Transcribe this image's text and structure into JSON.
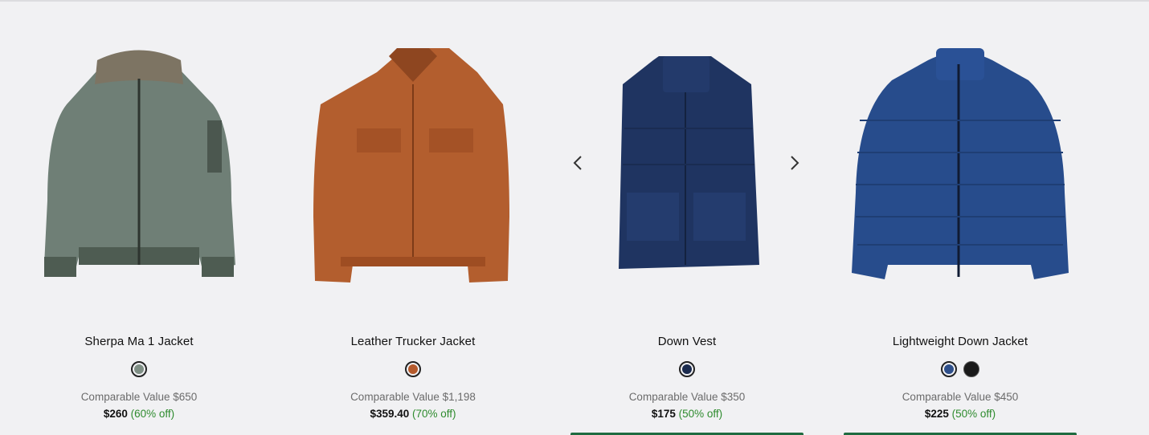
{
  "carousel": {
    "prev_label": "previous",
    "next_label": "next"
  },
  "products": [
    {
      "name": "Sherpa Ma 1 Jacket",
      "swatches": [
        {
          "color": "#7f8f85",
          "selected": true
        }
      ],
      "comparable": "Comparable Value $650",
      "price": "$260",
      "discount": "(60% off)"
    },
    {
      "name": "Leather Trucker Jacket",
      "swatches": [
        {
          "color": "#b55a2c",
          "selected": true
        }
      ],
      "comparable": "Comparable Value $1,198",
      "price": "$359.40",
      "discount": "(70% off)"
    },
    {
      "name": "Down Vest",
      "swatches": [
        {
          "color": "#1b2b4e",
          "selected": true
        }
      ],
      "comparable": "Comparable Value $350",
      "price": "$175",
      "discount": "(50% off)"
    },
    {
      "name": "Lightweight Down Jacket",
      "swatches": [
        {
          "color": "#2e4f8a",
          "selected": true
        },
        {
          "color": "#1a1a1a",
          "selected": false
        }
      ],
      "comparable": "Comparable Value $450",
      "price": "$225",
      "discount": "(50% off)"
    }
  ]
}
